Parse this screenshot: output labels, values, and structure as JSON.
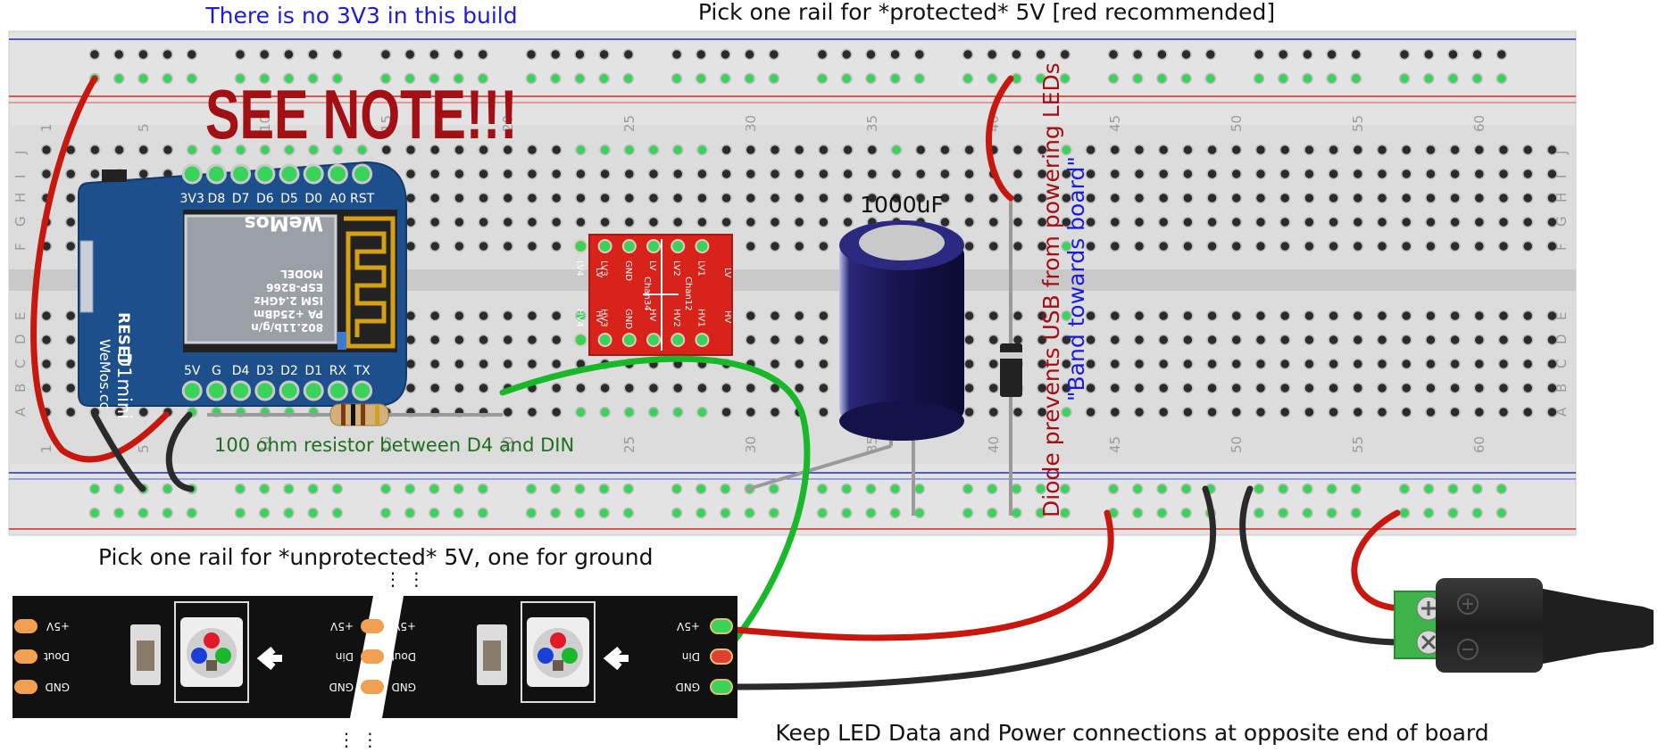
{
  "notes": {
    "no_3v3": "There is no 3V3 in this build",
    "protected_rail": "Pick one rail for *protected* 5V [red recommended]",
    "see_note": "SEE NOTE!!!",
    "resistor": "100 ohm resistor between D4 and DIN",
    "unprotected_rail": "Pick one rail for *unprotected* 5V, one for ground",
    "opposite_end": "Keep LED Data and Power connections at opposite end of board",
    "capacitor": "1000uF",
    "diode": "Diode prevents USB from powering LEDs",
    "band": "\"Band towards board\""
  },
  "breadboard": {
    "column_labels": [
      "1",
      "5",
      "10",
      "15",
      "20",
      "25",
      "30",
      "35",
      "40",
      "45",
      "50",
      "55",
      "60"
    ],
    "row_labels_top": [
      "J",
      "I",
      "H",
      "G",
      "F"
    ],
    "row_labels_bottom": [
      "E",
      "D",
      "C",
      "B",
      "A"
    ]
  },
  "wemos": {
    "top_pins": [
      "3V3",
      "D8",
      "D7",
      "D6",
      "D5",
      "D0",
      "A0",
      "RST"
    ],
    "bottom_pins": [
      "5V",
      "G",
      "D4",
      "D3",
      "D2",
      "D1",
      "RX",
      "TX"
    ],
    "reset_label": "RESET",
    "name": "D1mini",
    "brand": "WeMos.cc",
    "module_lines": [
      "802.11b/g/n",
      "PA +25dBm",
      "ISM 2.4GHz",
      "ESP-8266",
      "MODEL",
      "WeMos"
    ]
  },
  "level_shifter": {
    "top_pins": [
      "LV4",
      "LV3",
      "GND",
      "LV",
      "LV2",
      "LV1"
    ],
    "bottom_pins": [
      "HV4",
      "HV3",
      "GND",
      "HV",
      "HV2",
      "HV1"
    ],
    "channels": [
      "Chan34",
      "Chan12"
    ],
    "side_left": "LV",
    "side_right": "LV",
    "side_left_b": "HV",
    "side_right_b": "HV"
  },
  "led_strip": {
    "pad_labels": [
      "+5V",
      "Dout",
      "GND"
    ],
    "pad_labels_right": [
      "+5V",
      "Din",
      "GND"
    ]
  },
  "colors": {
    "rail_red": "#d9261c",
    "rail_blue": "#1a2bd6",
    "wire_red": "#c8170e",
    "wire_black": "#2a2a2a",
    "wire_green": "#19b82a",
    "board": "#d6d6d6",
    "wemos_blue": "#1d4f8c",
    "level_shifter": "#d8231b",
    "cap_body": "#1c1a5a",
    "note_blue": "#1b1bd8",
    "note_dark_red": "#a20f14",
    "note_green": "#1e6e1e"
  }
}
